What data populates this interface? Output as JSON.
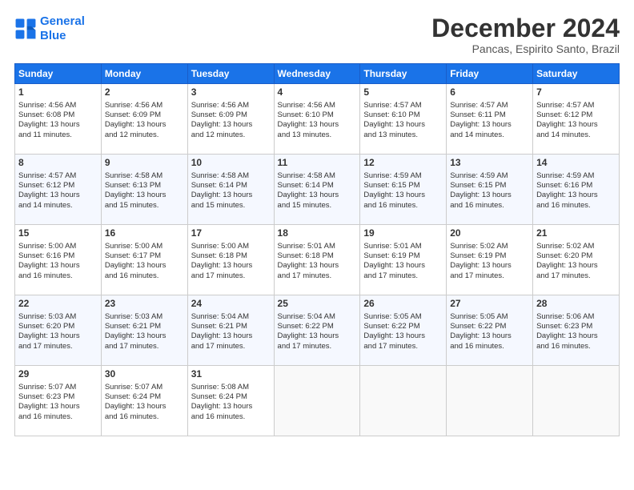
{
  "logo": {
    "line1": "General",
    "line2": "Blue"
  },
  "title": "December 2024",
  "subtitle": "Pancas, Espirito Santo, Brazil",
  "headers": [
    "Sunday",
    "Monday",
    "Tuesday",
    "Wednesday",
    "Thursday",
    "Friday",
    "Saturday"
  ],
  "weeks": [
    [
      {
        "day": "1",
        "sunrise": "4:56 AM",
        "sunset": "6:08 PM",
        "daylight": "13 hours and 11 minutes."
      },
      {
        "day": "2",
        "sunrise": "4:56 AM",
        "sunset": "6:09 PM",
        "daylight": "13 hours and 12 minutes."
      },
      {
        "day": "3",
        "sunrise": "4:56 AM",
        "sunset": "6:09 PM",
        "daylight": "13 hours and 12 minutes."
      },
      {
        "day": "4",
        "sunrise": "4:56 AM",
        "sunset": "6:10 PM",
        "daylight": "13 hours and 13 minutes."
      },
      {
        "day": "5",
        "sunrise": "4:57 AM",
        "sunset": "6:10 PM",
        "daylight": "13 hours and 13 minutes."
      },
      {
        "day": "6",
        "sunrise": "4:57 AM",
        "sunset": "6:11 PM",
        "daylight": "13 hours and 14 minutes."
      },
      {
        "day": "7",
        "sunrise": "4:57 AM",
        "sunset": "6:12 PM",
        "daylight": "13 hours and 14 minutes."
      }
    ],
    [
      {
        "day": "8",
        "sunrise": "4:57 AM",
        "sunset": "6:12 PM",
        "daylight": "13 hours and 14 minutes."
      },
      {
        "day": "9",
        "sunrise": "4:58 AM",
        "sunset": "6:13 PM",
        "daylight": "13 hours and 15 minutes."
      },
      {
        "day": "10",
        "sunrise": "4:58 AM",
        "sunset": "6:14 PM",
        "daylight": "13 hours and 15 minutes."
      },
      {
        "day": "11",
        "sunrise": "4:58 AM",
        "sunset": "6:14 PM",
        "daylight": "13 hours and 15 minutes."
      },
      {
        "day": "12",
        "sunrise": "4:59 AM",
        "sunset": "6:15 PM",
        "daylight": "13 hours and 16 minutes."
      },
      {
        "day": "13",
        "sunrise": "4:59 AM",
        "sunset": "6:15 PM",
        "daylight": "13 hours and 16 minutes."
      },
      {
        "day": "14",
        "sunrise": "4:59 AM",
        "sunset": "6:16 PM",
        "daylight": "13 hours and 16 minutes."
      }
    ],
    [
      {
        "day": "15",
        "sunrise": "5:00 AM",
        "sunset": "6:16 PM",
        "daylight": "13 hours and 16 minutes."
      },
      {
        "day": "16",
        "sunrise": "5:00 AM",
        "sunset": "6:17 PM",
        "daylight": "13 hours and 16 minutes."
      },
      {
        "day": "17",
        "sunrise": "5:00 AM",
        "sunset": "6:18 PM",
        "daylight": "13 hours and 17 minutes."
      },
      {
        "day": "18",
        "sunrise": "5:01 AM",
        "sunset": "6:18 PM",
        "daylight": "13 hours and 17 minutes."
      },
      {
        "day": "19",
        "sunrise": "5:01 AM",
        "sunset": "6:19 PM",
        "daylight": "13 hours and 17 minutes."
      },
      {
        "day": "20",
        "sunrise": "5:02 AM",
        "sunset": "6:19 PM",
        "daylight": "13 hours and 17 minutes."
      },
      {
        "day": "21",
        "sunrise": "5:02 AM",
        "sunset": "6:20 PM",
        "daylight": "13 hours and 17 minutes."
      }
    ],
    [
      {
        "day": "22",
        "sunrise": "5:03 AM",
        "sunset": "6:20 PM",
        "daylight": "13 hours and 17 minutes."
      },
      {
        "day": "23",
        "sunrise": "5:03 AM",
        "sunset": "6:21 PM",
        "daylight": "13 hours and 17 minutes."
      },
      {
        "day": "24",
        "sunrise": "5:04 AM",
        "sunset": "6:21 PM",
        "daylight": "13 hours and 17 minutes."
      },
      {
        "day": "25",
        "sunrise": "5:04 AM",
        "sunset": "6:22 PM",
        "daylight": "13 hours and 17 minutes."
      },
      {
        "day": "26",
        "sunrise": "5:05 AM",
        "sunset": "6:22 PM",
        "daylight": "13 hours and 17 minutes."
      },
      {
        "day": "27",
        "sunrise": "5:05 AM",
        "sunset": "6:22 PM",
        "daylight": "13 hours and 16 minutes."
      },
      {
        "day": "28",
        "sunrise": "5:06 AM",
        "sunset": "6:23 PM",
        "daylight": "13 hours and 16 minutes."
      }
    ],
    [
      {
        "day": "29",
        "sunrise": "5:07 AM",
        "sunset": "6:23 PM",
        "daylight": "13 hours and 16 minutes."
      },
      {
        "day": "30",
        "sunrise": "5:07 AM",
        "sunset": "6:24 PM",
        "daylight": "13 hours and 16 minutes."
      },
      {
        "day": "31",
        "sunrise": "5:08 AM",
        "sunset": "6:24 PM",
        "daylight": "13 hours and 16 minutes."
      },
      null,
      null,
      null,
      null
    ]
  ],
  "labels": {
    "sunrise": "Sunrise:",
    "sunset": "Sunset:",
    "daylight": "Daylight:"
  }
}
